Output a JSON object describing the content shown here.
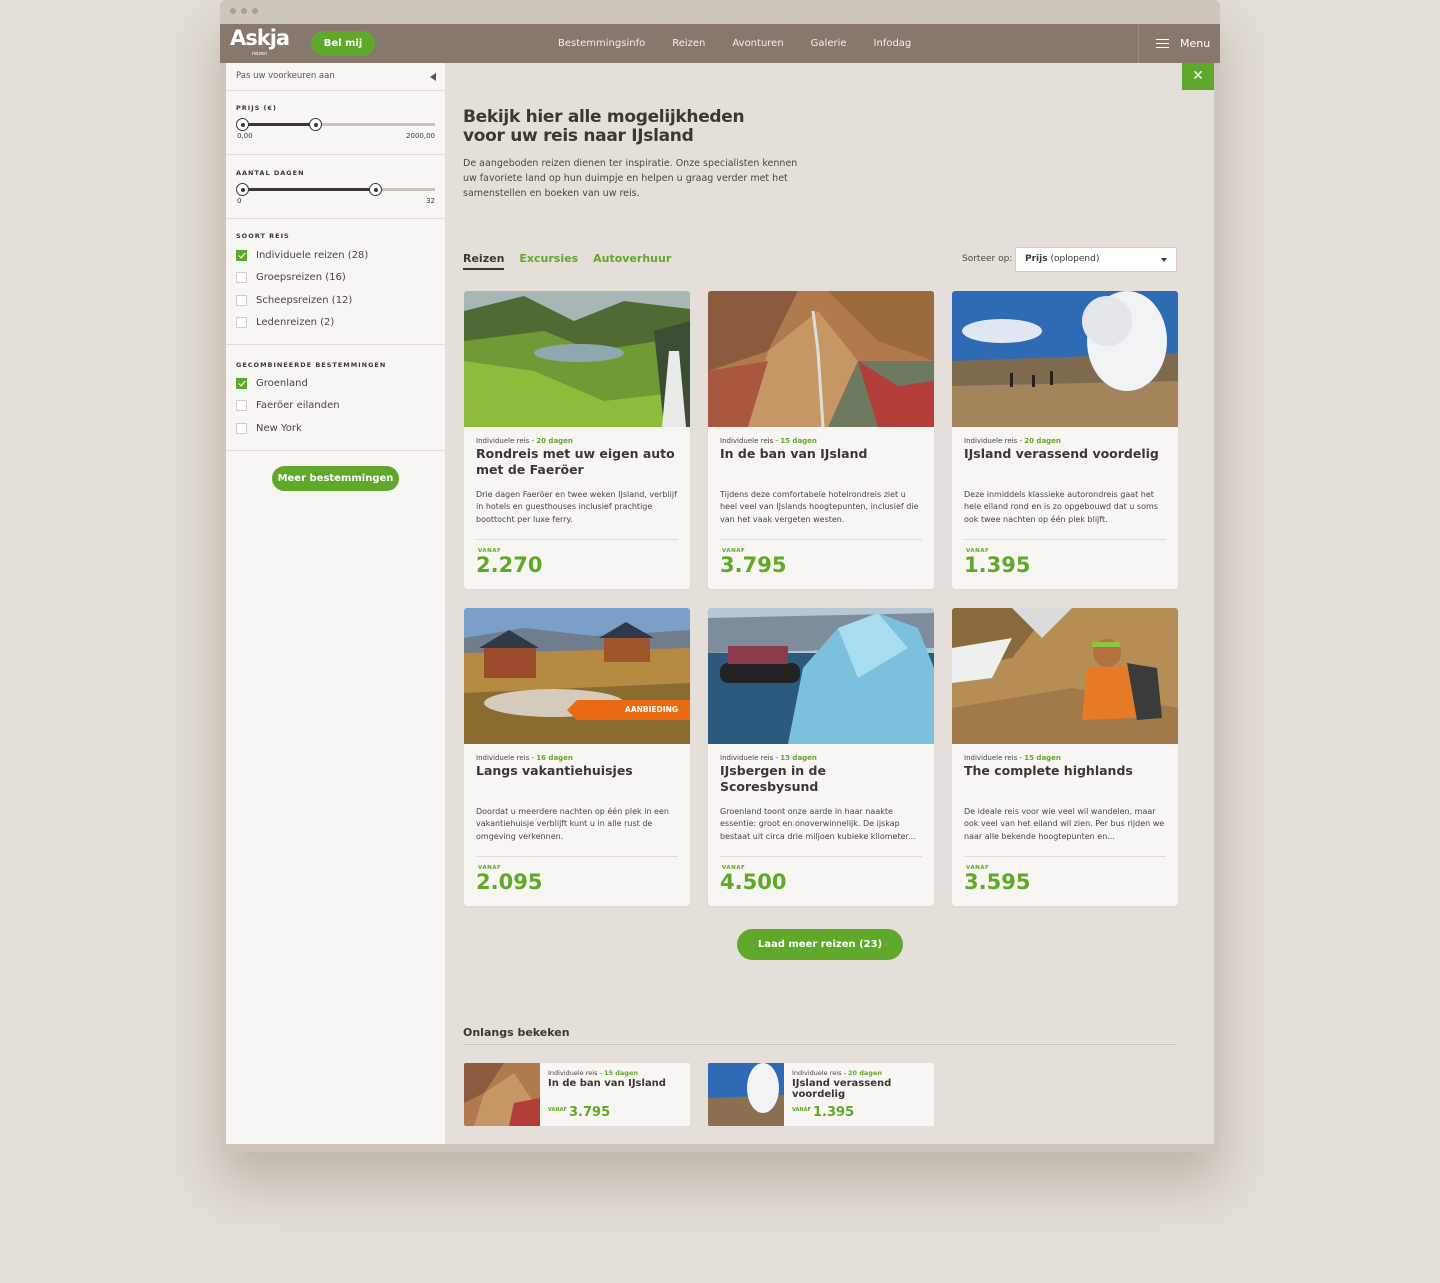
{
  "header": {
    "logo": "Askja",
    "logo_sub": "reizen",
    "call_button": "Bel mij",
    "nav": [
      "Bestemmingsinfo",
      "Reizen",
      "Avonturen",
      "Galerie",
      "Infodag"
    ],
    "menu_label": "Menu"
  },
  "sidebar": {
    "toggle_label": "Pas uw voorkeuren aan",
    "price": {
      "title": "PRIJS (€)",
      "min_label": "0,00",
      "max_label": "2000,00",
      "range": [
        0,
        0.36
      ]
    },
    "days": {
      "title": "AANTAL DAGEN",
      "min_label": "0",
      "max_label": "32",
      "range": [
        0,
        0.69
      ]
    },
    "trip_type": {
      "title": "SOORT REIS",
      "options": [
        {
          "label": "Individuele reizen (28)",
          "checked": true
        },
        {
          "label": "Groepsreizen (16)",
          "checked": false
        },
        {
          "label": "Scheepsreizen (12)",
          "checked": false
        },
        {
          "label": "Ledenreizen (2)",
          "checked": false
        }
      ]
    },
    "destinations": {
      "title": "GECOMBINEERDE BESTEMMINGEN",
      "options": [
        {
          "label": "Groenland",
          "checked": true
        },
        {
          "label": "Faeröer eilanden",
          "checked": false
        },
        {
          "label": "New York",
          "checked": false
        }
      ]
    },
    "more_button": "Meer bestemmingen"
  },
  "main": {
    "title": "Bekijk hier alle mogelijkheden voor uw reis naar IJsland",
    "intro": "De aangeboden reizen dienen ter inspiratie. Onze specialisten kennen uw favoriete land op hun duimpje en helpen u graag verder met het samenstellen en boeken van uw reis.",
    "tabs": [
      "Reizen",
      "Excursies",
      "Autoverhuur"
    ],
    "sort_label": "Sorteer op:",
    "sort_value_bold": "Prijs",
    "sort_value": "(oplopend)",
    "cards": [
      {
        "type": "Individuele reis - ",
        "days": "20 dagen",
        "title": "Rondreis met uw eigen auto met de Faeröer",
        "desc": "Drie dagen Faeröer en twee weken IJsland, verblijf in hotels en guesthouses inclusief prachtige boottocht per luxe ferry.",
        "from": "VANAF",
        "price": "2.270"
      },
      {
        "type": "Individuele reis - ",
        "days": "15 dagen",
        "title": "In de ban van IJsland",
        "desc": "Tijdens deze comfortabele hotelrondreis ziet u heel veel van IJslands hoogtepunten, inclusief die van het vaak vergeten westen.",
        "from": "VANAF",
        "price": "3.795"
      },
      {
        "type": "Individuele reis - ",
        "days": "20 dagen",
        "title": "IJsland verassend voordelig",
        "desc": "Deze inmiddels klassieke autorondreis gaat het hele eiland rond en is zo opgebouwd dat u soms ook twee nachten op één plek blijft.",
        "from": "VANAF",
        "price": "1.395"
      },
      {
        "type": "Individuele reis - ",
        "days": "16 dagen",
        "title": "Langs vakantiehuisjes",
        "desc": "Doordat u meerdere nachten op één plek in een vakantiehuisje verblijft kunt u in alle rust de omgeving verkennen.",
        "from": "VANAF",
        "price": "2.095",
        "badge": "AANBIEDING"
      },
      {
        "type": "Individuele reis - ",
        "days": "13 dagen",
        "title": "IJsbergen in de Scoresbysund",
        "desc": "Groenland toont onze aarde in haar naakte essentie: groot en onoverwinnelijk. De ijskap bestaat uit circa drie miljoen kubieke kilometer...",
        "from": "VANAF",
        "price": "4.500"
      },
      {
        "type": "Individuele reis - ",
        "days": "15 dagen",
        "title": "The complete highlands",
        "desc": "De ideale reis voor wie veel wil wandelen, maar ook veel van het eiland wil zien. Per bus rijden we naar alle bekende hoogtepunten en...",
        "from": "VANAF",
        "price": "3.595"
      }
    ],
    "load_more": "Laad meer reizen (23)",
    "recent_title": "Onlangs bekeken",
    "recent": [
      {
        "type": "Individuele reis - ",
        "days": "15 dagen",
        "title": "In de ban van IJsland",
        "from": "VANAF",
        "price": "3.795"
      },
      {
        "type": "Individuele reis - ",
        "days": "20 dagen",
        "title": "IJsland verassend voordelig",
        "from": "VANAF",
        "price": "1.395"
      }
    ]
  },
  "colors": {
    "accent": "#5fa829",
    "header": "#86786c",
    "offer": "#ea6a12"
  }
}
